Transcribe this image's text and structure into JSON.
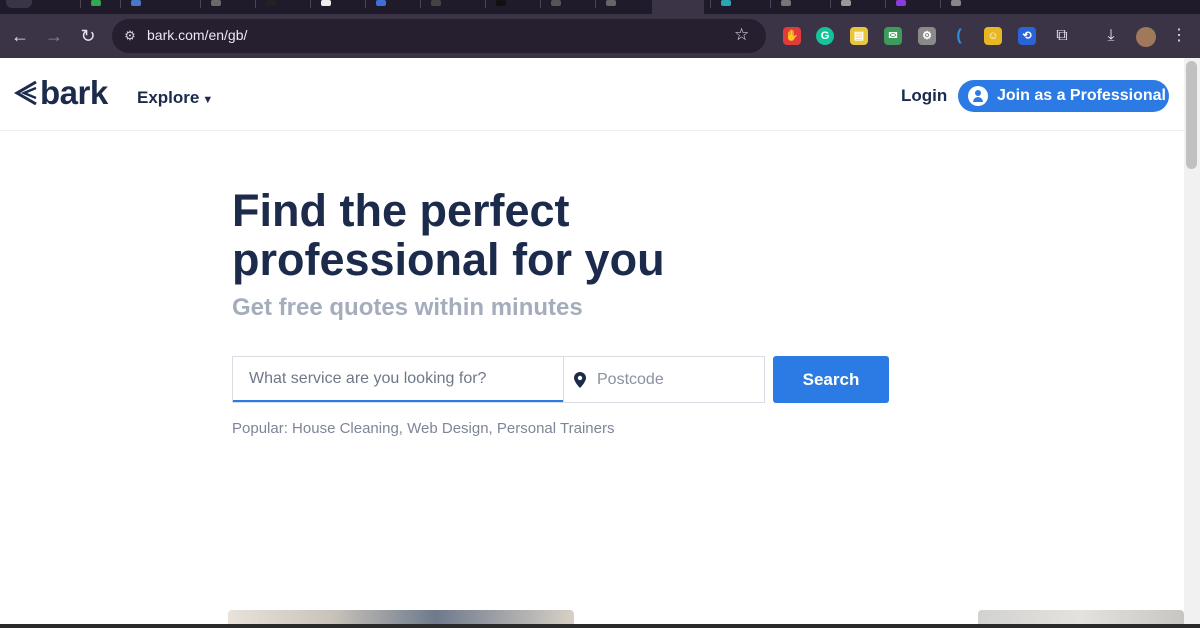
{
  "browser": {
    "url": "bark.com/en/gb/",
    "extension_icons": [
      {
        "name": "adblock-icon",
        "color": "#e23b3b",
        "glyph": "✋"
      },
      {
        "name": "grammarly-icon",
        "color": "#15c39a",
        "glyph": "G"
      },
      {
        "name": "sticky-notes-icon",
        "color": "#e9c53b",
        "glyph": "▤"
      },
      {
        "name": "mail-tracker-icon",
        "color": "#3e9b5a",
        "glyph": "✉"
      },
      {
        "name": "extension-gray-icon",
        "color": "#8a8a8a",
        "glyph": "⚙"
      },
      {
        "name": "extension-blue-c-icon",
        "color": "#2d8fe0",
        "glyph": "("
      },
      {
        "name": "extension-yellow-icon",
        "color": "#e8b623",
        "glyph": "☺"
      },
      {
        "name": "extension-blue-icon",
        "color": "#2a64d8",
        "glyph": "⟲"
      }
    ]
  },
  "header": {
    "logo_text": "bark",
    "explore_label": "Explore",
    "login_label": "Login",
    "join_label": "Join as a Professional"
  },
  "hero": {
    "title_line1": "Find the perfect",
    "title_line2": "professional for you",
    "subtitle": "Get free quotes within minutes"
  },
  "search": {
    "service_placeholder": "What service are you looking for?",
    "postcode_placeholder": "Postcode",
    "button_label": "Search",
    "popular_prefix": "Popular:",
    "popular_items": [
      "House Cleaning,",
      "Web Design,",
      "Personal Trainers"
    ]
  },
  "colors": {
    "brand_navy": "#1c2a4c",
    "accent_blue": "#2c7be5"
  }
}
